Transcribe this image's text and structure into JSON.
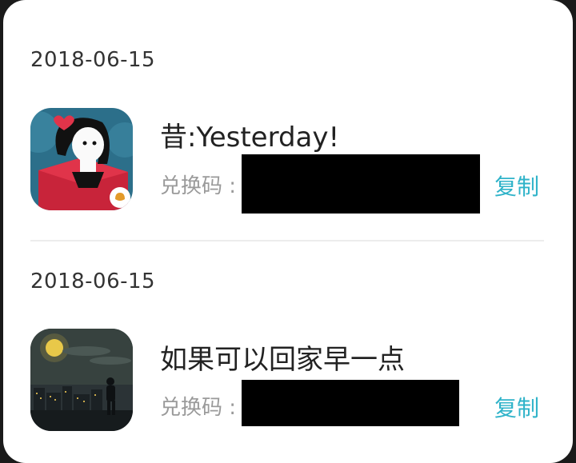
{
  "gifts": [
    {
      "date": "2018-06-15",
      "title": "昔:Yesterday!",
      "code_label": "兑换码 :",
      "code_value": "",
      "copy_label": "复制",
      "icon": "yesterday-game-icon"
    },
    {
      "date": "2018-06-15",
      "title": "如果可以回家早一点",
      "code_label": "兑换码 :",
      "code_value": "",
      "copy_label": "复制",
      "icon": "home-early-game-icon"
    }
  ],
  "colors": {
    "accent": "#2fb3c9",
    "label": "#9a9a9a",
    "divider": "#ececec"
  }
}
